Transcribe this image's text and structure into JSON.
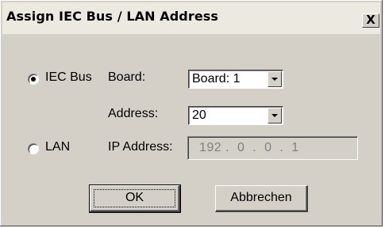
{
  "dialog": {
    "title": "Assign IEC Bus / LAN Address",
    "close_glyph": "X"
  },
  "iec": {
    "radio_label": "IEC Bus",
    "selected": true,
    "board_label": "Board:",
    "board_value": "Board: 1",
    "address_label": "Address:",
    "address_value": "20"
  },
  "lan": {
    "radio_label": "LAN",
    "selected": false,
    "ip_label": "IP Address:",
    "ip_value": "192 .  0  .  0  .  1"
  },
  "buttons": {
    "ok": "OK",
    "cancel": "Abbrechen"
  },
  "colors": {
    "dialog_bg": "#d4d0c8",
    "titlebar_bg": "#ece9e0",
    "disabled_text": "#808080"
  }
}
